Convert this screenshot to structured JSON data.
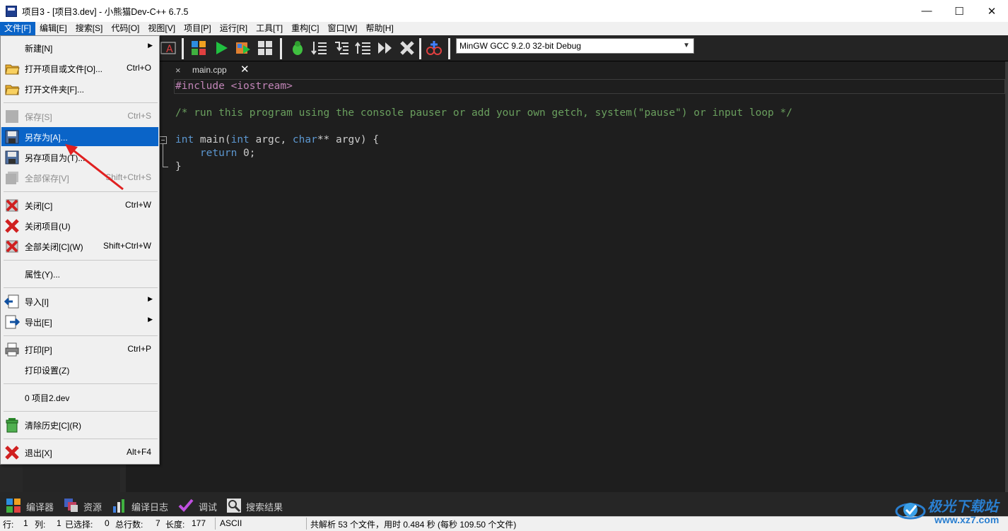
{
  "window": {
    "title": "项目3 - [项目3.dev] - 小熊猫Dev-C++ 6.7.5",
    "minimize_glyph": "—",
    "maximize_glyph": "☐",
    "close_glyph": "✕"
  },
  "menubar": {
    "items": [
      "文件[F]",
      "编辑[E]",
      "搜索[S]",
      "代码[O]",
      "视图[V]",
      "项目[P]",
      "运行[R]",
      "工具[T]",
      "重构[C]",
      "窗口[W]",
      "帮助[H]"
    ]
  },
  "toolbar": {
    "compiler": "MinGW GCC 9.2.0 32-bit Debug"
  },
  "editor": {
    "tab_label": "main.cpp",
    "tab_close_glyph": "✕",
    "other_tab_close_glyph": "×",
    "lines": {
      "l1": "#include <iostream>",
      "l3": "/* run this program using the console pauser or add your own getch, system(\"pause\") or input loop */",
      "l5_kw1": "int",
      "l5_a": " main(",
      "l5_kw2": "int",
      "l5_b": " argc, ",
      "l5_kw3": "char",
      "l5_c": "** argv) {",
      "l6_kw": "    return",
      "l6_rest": " 0;",
      "l7": "}"
    }
  },
  "file_menu": {
    "new": "新建[N]",
    "open_project_or_file": "打开项目或文件[O]...",
    "open_project_or_file_sc": "Ctrl+O",
    "open_folder": "打开文件夹[F]...",
    "save": "保存[S]",
    "save_sc": "Ctrl+S",
    "save_as": "另存为[A]...",
    "save_project_as": "另存项目为(T)...",
    "save_all": "全部保存[V]",
    "save_all_sc": "Shift+Ctrl+S",
    "close": "关闭[C]",
    "close_sc": "Ctrl+W",
    "close_project": "关闭项目(U)",
    "close_all": "全部关闭[C](W)",
    "close_all_sc": "Shift+Ctrl+W",
    "properties": "属性(Y)...",
    "import": "导入[I]",
    "export": "导出[E]",
    "print": "打印[P]",
    "print_sc": "Ctrl+P",
    "print_setup": "打印设置(Z)",
    "recent": "0 项目2.dev",
    "clear_history": "清除历史[C](R)",
    "exit": "退出[X]",
    "exit_sc": "Alt+F4",
    "submenu_arrow": "▶"
  },
  "bottom_tabs": {
    "compiler": "编译器",
    "resources": "资源",
    "compile_log": "编译日志",
    "debug": "调试",
    "search_results": "搜索结果"
  },
  "statusbar": {
    "row_label": "行:",
    "row_value": "1",
    "col_label": "列:",
    "col_value": "1",
    "selected_label": "已选择:",
    "selected_value": "0",
    "total_lines_label": "总行数:",
    "total_lines_value": "7",
    "length_label": "长度:",
    "length_value": "177",
    "encoding": "ASCII",
    "parse_info": "共解析 53 个文件，用时 0.484 秒 (每秒 109.50 个文件)"
  },
  "watermark": {
    "text": "极光下载站",
    "url": "www.xz7.com"
  },
  "colors": {
    "menu_highlight": "#0a64c8",
    "editor_bg": "#1e1e1e",
    "keyword": "#5c97d0",
    "comment": "#6a9f5e",
    "preprocessor": "#c285b8",
    "arrow": "#e02020"
  }
}
